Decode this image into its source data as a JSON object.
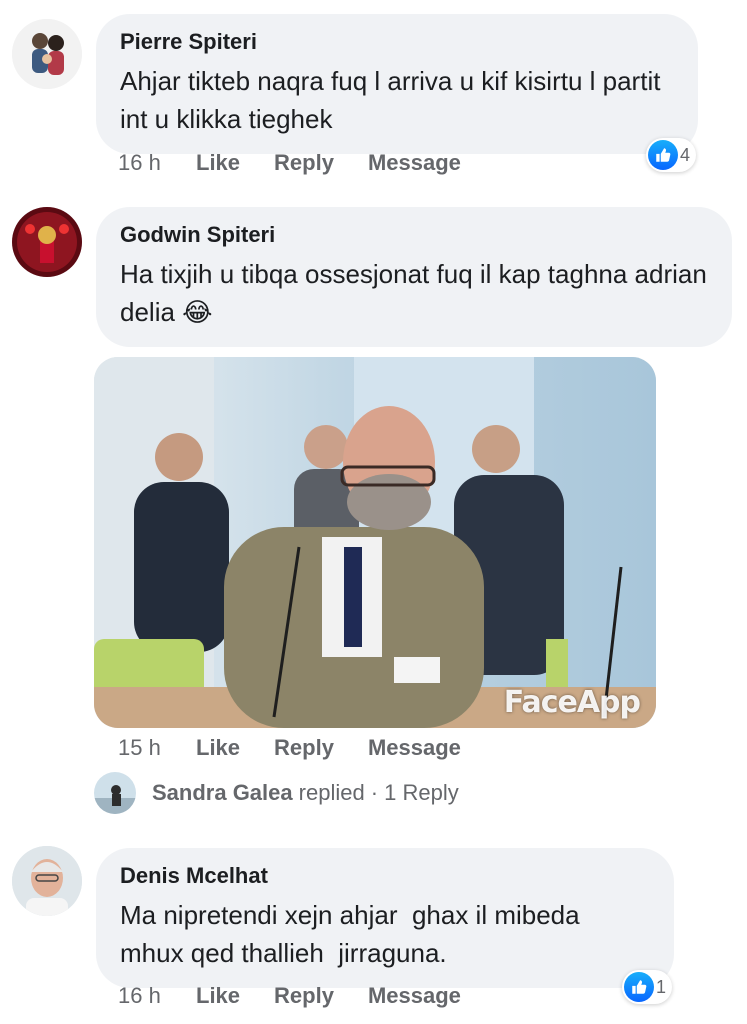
{
  "comments": [
    {
      "author": "Pierre Spiteri",
      "text": "Ahjar tikteb naqra fuq l arriva u kif kisirtu l partit int u klikka tieghek",
      "time": "16 h",
      "reaction_count": "4"
    },
    {
      "author": "Godwin Spiteri",
      "text": "Ha tixjih u tibqa ossesjonat fuq il kap taghna adrian delia",
      "emoji": "😂",
      "time": "15 h",
      "photo_watermark": "FaceApp",
      "reply_summary": {
        "name": "Sandra Galea",
        "replied": "replied",
        "count": "· 1 Reply"
      }
    },
    {
      "author": "Denis Mcelhat",
      "text": "Ma nipretendi xejn ahjar  ghax il mibeda mhux qed thallieh  jirraguna.",
      "time": "16 h",
      "reaction_count": "1"
    }
  ],
  "actions": {
    "like": "Like",
    "reply": "Reply",
    "message": "Message"
  },
  "colors": {
    "bubble": "#f0f2f5",
    "secondary_text": "#65676b",
    "like_blue": "#0866ff"
  },
  "icons": {
    "like": "thumbs-up-icon"
  }
}
